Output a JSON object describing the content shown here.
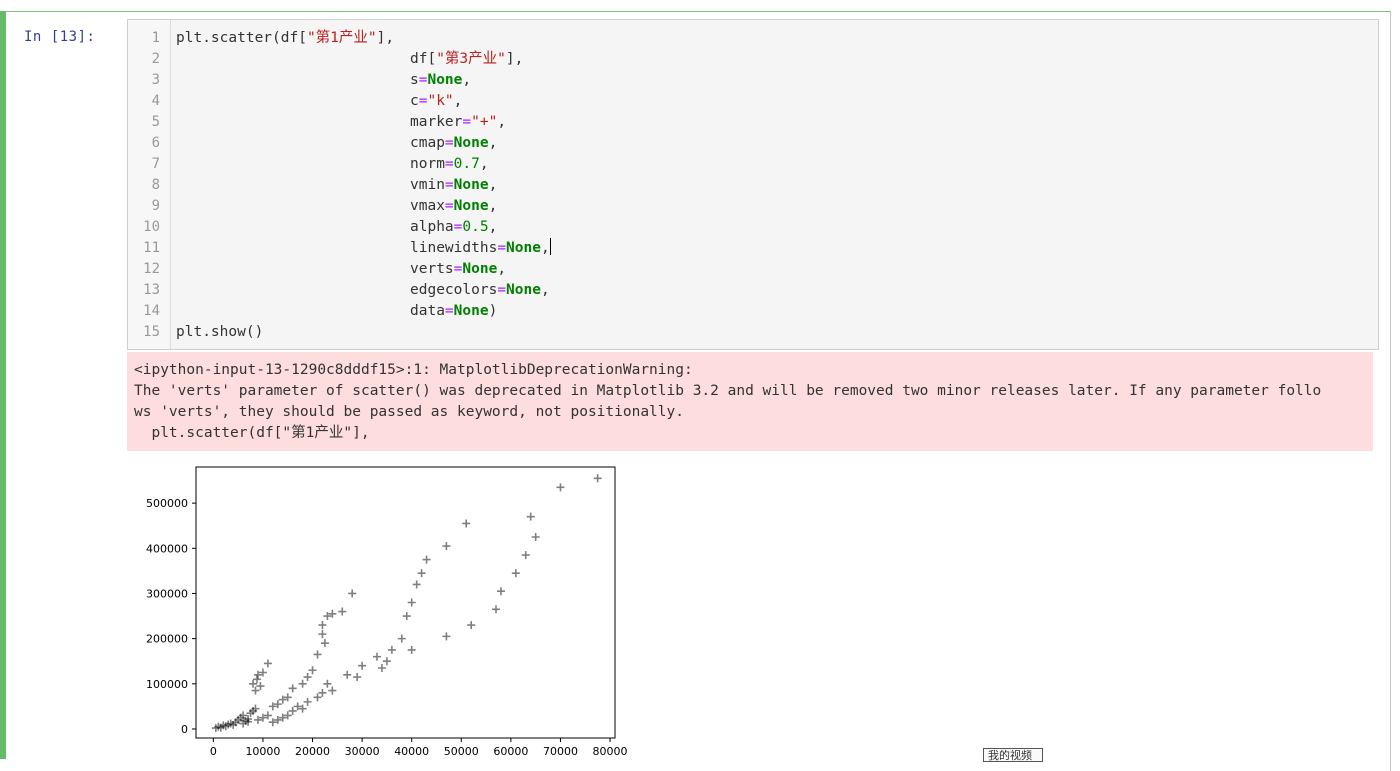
{
  "cell": {
    "prompt": "In  [13]:",
    "lines": [
      {
        "n": "1"
      },
      {
        "n": "2"
      },
      {
        "n": "3"
      },
      {
        "n": "4"
      },
      {
        "n": "5"
      },
      {
        "n": "6"
      },
      {
        "n": "7"
      },
      {
        "n": "8"
      },
      {
        "n": "9"
      },
      {
        "n": "10"
      },
      {
        "n": "11"
      },
      {
        "n": "12"
      },
      {
        "n": "13"
      },
      {
        "n": "14"
      },
      {
        "n": "15"
      }
    ],
    "code": {
      "l1_a": "plt.scatter(df[",
      "l1_s": "\"第1产业\"",
      "l1_b": "],",
      "l2_a": "df[",
      "l2_s": "\"第3产业\"",
      "l2_b": "],",
      "l3_k": "s",
      "l3_v": "None",
      "l4_k": "c",
      "l4_v": "\"k\"",
      "l5_k": "marker",
      "l5_v": "\"+\"",
      "l6_k": "cmap",
      "l6_v": "None",
      "l7_k": "norm",
      "l7_v": "0.7",
      "l8_k": "vmin",
      "l8_v": "None",
      "l9_k": "vmax",
      "l9_v": "None",
      "l10_k": "alpha",
      "l10_v": "0.5",
      "l11_k": "linewidths",
      "l11_v": "None",
      "l12_k": "verts",
      "l12_v": "None",
      "l13_k": "edgecolors",
      "l13_v": "None",
      "l14_k": "data",
      "l14_v": "None",
      "l15": "plt.show()"
    }
  },
  "stderr": {
    "line1": "<ipython-input-13-1290c8dddf15>:1: MatplotlibDeprecationWarning:",
    "line2": "The 'verts' parameter of scatter() was deprecated in Matplotlib 3.2 and will be removed two minor releases later. If any parameter follo",
    "line3": "ws 'verts', they should be passed as keyword, not positionally.",
    "line4": "  plt.scatter(df[\"第1产业\"],"
  },
  "tag_label": "我的视频",
  "chart_data": {
    "type": "scatter",
    "marker": "+",
    "color": "#000000",
    "alpha": 0.5,
    "xlim": [
      -3500,
      81000
    ],
    "ylim": [
      -20000,
      580000
    ],
    "xticks": [
      "0",
      "10000",
      "20000",
      "30000",
      "40000",
      "50000",
      "60000",
      "70000",
      "80000"
    ],
    "yticks": [
      "0",
      "100000",
      "200000",
      "300000",
      "400000",
      "500000"
    ],
    "grid": false,
    "points": [
      [
        500,
        2000
      ],
      [
        1000,
        5000
      ],
      [
        1500,
        3000
      ],
      [
        2000,
        8000
      ],
      [
        2500,
        6000
      ],
      [
        3000,
        10000
      ],
      [
        3500,
        12000
      ],
      [
        4000,
        9000
      ],
      [
        4500,
        15000
      ],
      [
        5000,
        20000
      ],
      [
        5500,
        25000
      ],
      [
        6000,
        30000
      ],
      [
        6500,
        18000
      ],
      [
        7000,
        22000
      ],
      [
        7500,
        35000
      ],
      [
        8000,
        40000
      ],
      [
        8500,
        45000
      ],
      [
        8000,
        100000
      ],
      [
        8500,
        85000
      ],
      [
        8800,
        110000
      ],
      [
        9000,
        120000
      ],
      [
        9500,
        95000
      ],
      [
        10000,
        125000
      ],
      [
        11000,
        145000
      ],
      [
        9000,
        20000
      ],
      [
        10000,
        25000
      ],
      [
        11000,
        30000
      ],
      [
        12000,
        50000
      ],
      [
        13000,
        55000
      ],
      [
        14000,
        65000
      ],
      [
        15000,
        70000
      ],
      [
        16000,
        90000
      ],
      [
        18000,
        100000
      ],
      [
        19000,
        115000
      ],
      [
        20000,
        130000
      ],
      [
        21000,
        165000
      ],
      [
        22000,
        210000
      ],
      [
        22000,
        230000
      ],
      [
        22500,
        190000
      ],
      [
        23000,
        250000
      ],
      [
        24000,
        255000
      ],
      [
        26000,
        260000
      ],
      [
        28000,
        300000
      ],
      [
        21000,
        70000
      ],
      [
        22000,
        80000
      ],
      [
        23000,
        100000
      ],
      [
        24000,
        85000
      ],
      [
        27000,
        120000
      ],
      [
        29000,
        115000
      ],
      [
        30000,
        140000
      ],
      [
        33000,
        160000
      ],
      [
        34000,
        135000
      ],
      [
        35000,
        150000
      ],
      [
        36000,
        175000
      ],
      [
        38000,
        200000
      ],
      [
        39000,
        250000
      ],
      [
        40000,
        280000
      ],
      [
        41000,
        320000
      ],
      [
        42000,
        345000
      ],
      [
        43000,
        375000
      ],
      [
        40000,
        175000
      ],
      [
        47000,
        405000
      ],
      [
        51000,
        455000
      ],
      [
        47000,
        205000
      ],
      [
        52000,
        230000
      ],
      [
        57000,
        265000
      ],
      [
        58000,
        305000
      ],
      [
        61000,
        345000
      ],
      [
        63000,
        385000
      ],
      [
        64000,
        470000
      ],
      [
        65000,
        425000
      ],
      [
        70000,
        535000
      ],
      [
        77500,
        555000
      ],
      [
        14000,
        25000
      ],
      [
        15000,
        30000
      ],
      [
        16000,
        40000
      ],
      [
        17000,
        50000
      ],
      [
        18000,
        45000
      ],
      [
        19000,
        60000
      ],
      [
        13000,
        20000
      ],
      [
        12000,
        15000
      ],
      [
        6000,
        12000
      ],
      [
        7000,
        16000
      ]
    ]
  }
}
